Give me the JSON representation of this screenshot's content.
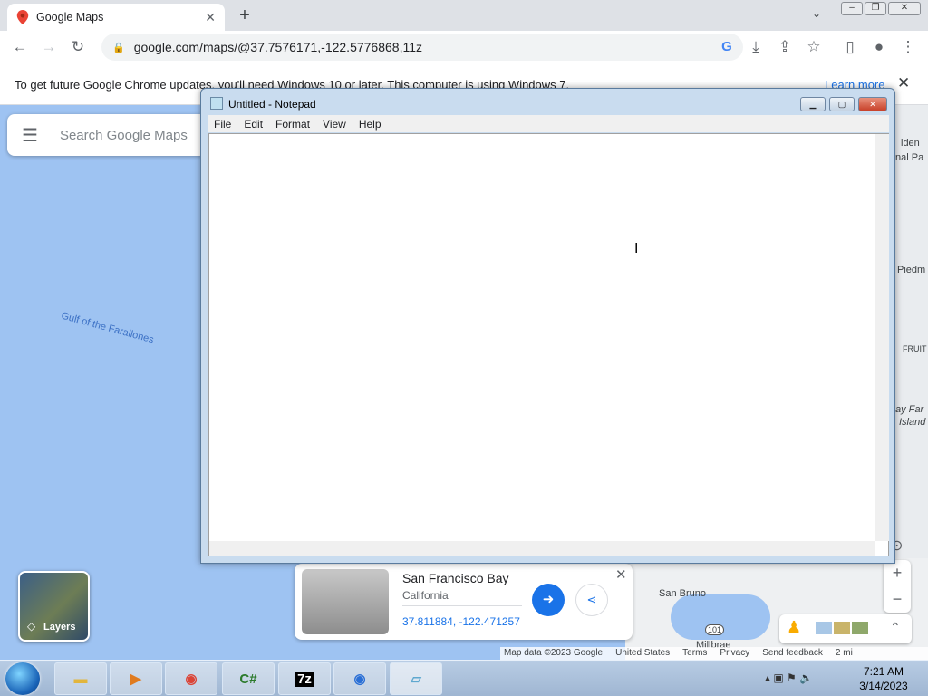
{
  "browser": {
    "tab_title": "Google Maps",
    "new_tab": "+",
    "url": "google.com/maps/@37.7576171,-122.5776868,11z",
    "infobar_message": "To get future Google Chrome updates, you'll need Windows 10 or later. This computer is using Windows 7.",
    "infobar_link": "Learn more"
  },
  "maps": {
    "search_placeholder": "Search Google Maps",
    "water_label": "Gulf of the Farallones",
    "edge_labels": [
      "lden",
      "nal Pa",
      "Piedm",
      "FRUIT",
      "ay Far",
      "Island"
    ],
    "city_labels": [
      "San Bruno",
      "Millbrae"
    ],
    "highway": "101",
    "layers_label": "Layers",
    "place": {
      "name": "San Francisco Bay",
      "region": "California",
      "coords": "37.811884, -122.471257"
    },
    "footer": [
      "Map data ©2023 Google",
      "United States",
      "Terms",
      "Privacy",
      "Send feedback",
      "2 mi"
    ]
  },
  "notepad": {
    "title": "Untitled - Notepad",
    "menu": [
      "File",
      "Edit",
      "Format",
      "View",
      "Help"
    ],
    "content": ""
  },
  "taskbar": {
    "apps": [
      "folder-icon",
      "media-player-icon",
      "chrome-icon",
      "csharp-icon",
      "7zip-icon",
      "chromium-icon",
      "notepad-icon"
    ],
    "time": "7:21 AM",
    "date": "3/14/2023"
  },
  "colors": {
    "map_water": "#9ec3f2",
    "accent": "#1a73e8"
  }
}
